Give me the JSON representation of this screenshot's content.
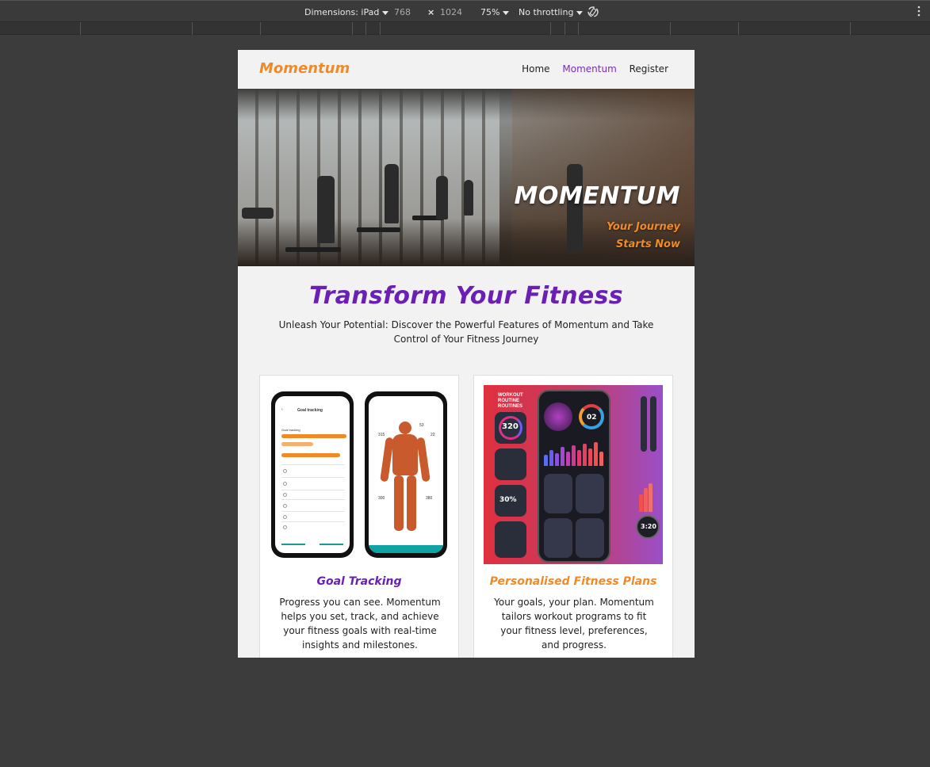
{
  "devtools": {
    "dimensions_label": "Dimensions: iPad",
    "width": "768",
    "times": "×",
    "height": "1024",
    "zoom": "75%",
    "throttling": "No throttling",
    "rotate_icon": "rotate-icon",
    "more_icon": "more-vert-icon"
  },
  "nav": {
    "brand": "Momentum",
    "links": [
      "Home",
      "Momentum",
      "Register"
    ],
    "active_index": 1
  },
  "hero": {
    "title": "MOMENTUM",
    "subtitle_line1": "Your Journey",
    "subtitle_line2": "Starts Now"
  },
  "intro": {
    "heading": "Transform Your Fitness",
    "text": "Unleash Your Potential: Discover the Powerful Features of Momentum and Take Control of Your Fitness Journey"
  },
  "cards": [
    {
      "title": "Goal Tracking",
      "title_color": "#6a1fb5",
      "text": "Progress you can see. Momentum helps you set, track, and achieve your fitness goals with real-time insights and milestones.",
      "phone_header": "Goal tracking",
      "phone_section": "Goal tracking",
      "anatomy_labels": [
        "53",
        "22",
        "315",
        "300",
        "380"
      ]
    },
    {
      "title": "Personalised Fitness Plans",
      "title_color": "#f08a26",
      "text": "Your goals, your plan. Momentum tailors workout programs to fit your fitness level, preferences, and progress.",
      "collage_heading": "WORKOUT ROUTINE ROUTINES",
      "stats": [
        "320",
        "02",
        "30%",
        "3:20"
      ]
    }
  ],
  "colors": {
    "brand_orange": "#f08a26",
    "brand_purple": "#6a1fb5",
    "page_bg": "#f2f2f2",
    "outer_bg": "#3c3c3c"
  }
}
